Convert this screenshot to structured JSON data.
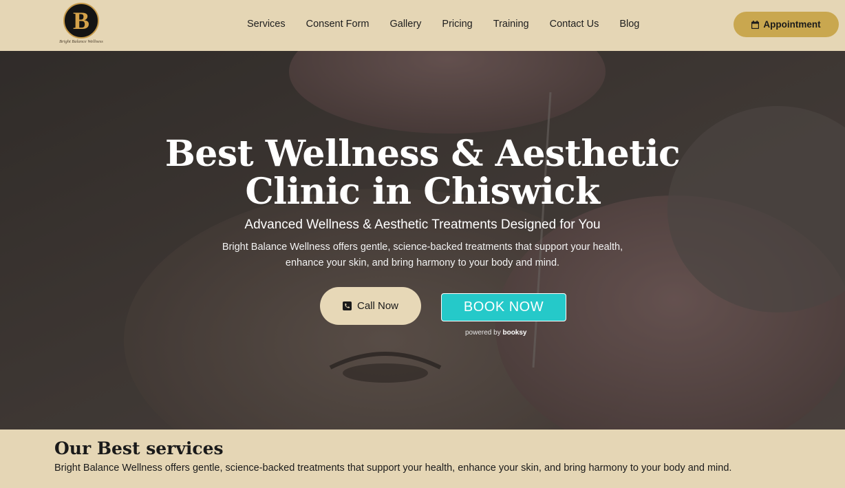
{
  "brand": {
    "logo_letter": "B",
    "logo_text": "Bright Balance Wellness",
    "accent_color": "#c9a74f",
    "background_color": "#e5d6b5"
  },
  "nav": {
    "items": [
      "Services",
      "Consent Form",
      "Gallery",
      "Pricing",
      "Training",
      "Contact Us",
      "Blog"
    ]
  },
  "header": {
    "appointment_label": "Appointment",
    "appointment_icon": "calendar-icon"
  },
  "hero": {
    "title_line1": "Best Wellness & Aesthetic",
    "title_line2": "Clinic in Chiswick",
    "subtitle": "Advanced Wellness & Aesthetic Treatments Designed for You",
    "description": "Bright Balance Wellness offers gentle, science-backed treatments that support your health, enhance your skin, and bring harmony to your body and mind.",
    "call_label": "Call Now",
    "call_icon": "phone-icon",
    "book_label": "BOOK NOW",
    "book_color": "#25c9c9",
    "powered_prefix": "powered by",
    "powered_brand": "booksy"
  },
  "services": {
    "title": "Our Best services",
    "description": "Bright Balance Wellness offers gentle, science-backed treatments that support your health, enhance your skin, and bring harmony to your body and mind."
  }
}
